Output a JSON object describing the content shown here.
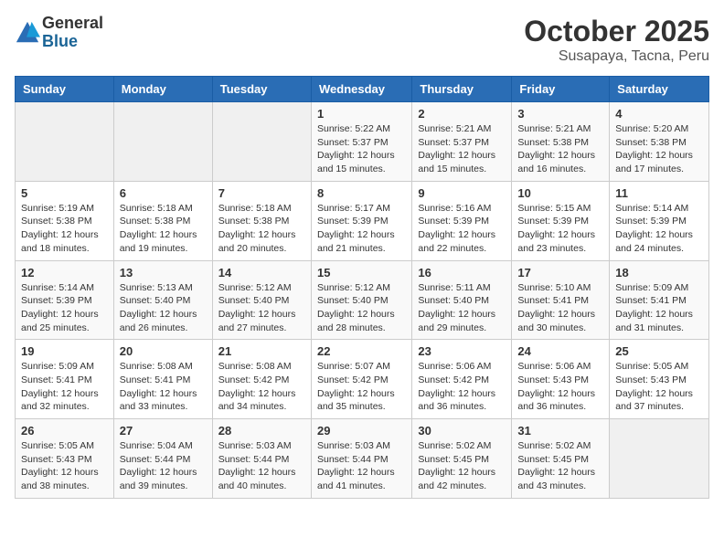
{
  "header": {
    "logo_general": "General",
    "logo_blue": "Blue",
    "month": "October 2025",
    "location": "Susapaya, Tacna, Peru"
  },
  "days_of_week": [
    "Sunday",
    "Monday",
    "Tuesday",
    "Wednesday",
    "Thursday",
    "Friday",
    "Saturday"
  ],
  "weeks": [
    [
      {
        "day": "",
        "info": ""
      },
      {
        "day": "",
        "info": ""
      },
      {
        "day": "",
        "info": ""
      },
      {
        "day": "1",
        "info": "Sunrise: 5:22 AM\nSunset: 5:37 PM\nDaylight: 12 hours\nand 15 minutes."
      },
      {
        "day": "2",
        "info": "Sunrise: 5:21 AM\nSunset: 5:37 PM\nDaylight: 12 hours\nand 15 minutes."
      },
      {
        "day": "3",
        "info": "Sunrise: 5:21 AM\nSunset: 5:38 PM\nDaylight: 12 hours\nand 16 minutes."
      },
      {
        "day": "4",
        "info": "Sunrise: 5:20 AM\nSunset: 5:38 PM\nDaylight: 12 hours\nand 17 minutes."
      }
    ],
    [
      {
        "day": "5",
        "info": "Sunrise: 5:19 AM\nSunset: 5:38 PM\nDaylight: 12 hours\nand 18 minutes."
      },
      {
        "day": "6",
        "info": "Sunrise: 5:18 AM\nSunset: 5:38 PM\nDaylight: 12 hours\nand 19 minutes."
      },
      {
        "day": "7",
        "info": "Sunrise: 5:18 AM\nSunset: 5:38 PM\nDaylight: 12 hours\nand 20 minutes."
      },
      {
        "day": "8",
        "info": "Sunrise: 5:17 AM\nSunset: 5:39 PM\nDaylight: 12 hours\nand 21 minutes."
      },
      {
        "day": "9",
        "info": "Sunrise: 5:16 AM\nSunset: 5:39 PM\nDaylight: 12 hours\nand 22 minutes."
      },
      {
        "day": "10",
        "info": "Sunrise: 5:15 AM\nSunset: 5:39 PM\nDaylight: 12 hours\nand 23 minutes."
      },
      {
        "day": "11",
        "info": "Sunrise: 5:14 AM\nSunset: 5:39 PM\nDaylight: 12 hours\nand 24 minutes."
      }
    ],
    [
      {
        "day": "12",
        "info": "Sunrise: 5:14 AM\nSunset: 5:39 PM\nDaylight: 12 hours\nand 25 minutes."
      },
      {
        "day": "13",
        "info": "Sunrise: 5:13 AM\nSunset: 5:40 PM\nDaylight: 12 hours\nand 26 minutes."
      },
      {
        "day": "14",
        "info": "Sunrise: 5:12 AM\nSunset: 5:40 PM\nDaylight: 12 hours\nand 27 minutes."
      },
      {
        "day": "15",
        "info": "Sunrise: 5:12 AM\nSunset: 5:40 PM\nDaylight: 12 hours\nand 28 minutes."
      },
      {
        "day": "16",
        "info": "Sunrise: 5:11 AM\nSunset: 5:40 PM\nDaylight: 12 hours\nand 29 minutes."
      },
      {
        "day": "17",
        "info": "Sunrise: 5:10 AM\nSunset: 5:41 PM\nDaylight: 12 hours\nand 30 minutes."
      },
      {
        "day": "18",
        "info": "Sunrise: 5:09 AM\nSunset: 5:41 PM\nDaylight: 12 hours\nand 31 minutes."
      }
    ],
    [
      {
        "day": "19",
        "info": "Sunrise: 5:09 AM\nSunset: 5:41 PM\nDaylight: 12 hours\nand 32 minutes."
      },
      {
        "day": "20",
        "info": "Sunrise: 5:08 AM\nSunset: 5:41 PM\nDaylight: 12 hours\nand 33 minutes."
      },
      {
        "day": "21",
        "info": "Sunrise: 5:08 AM\nSunset: 5:42 PM\nDaylight: 12 hours\nand 34 minutes."
      },
      {
        "day": "22",
        "info": "Sunrise: 5:07 AM\nSunset: 5:42 PM\nDaylight: 12 hours\nand 35 minutes."
      },
      {
        "day": "23",
        "info": "Sunrise: 5:06 AM\nSunset: 5:42 PM\nDaylight: 12 hours\nand 36 minutes."
      },
      {
        "day": "24",
        "info": "Sunrise: 5:06 AM\nSunset: 5:43 PM\nDaylight: 12 hours\nand 36 minutes."
      },
      {
        "day": "25",
        "info": "Sunrise: 5:05 AM\nSunset: 5:43 PM\nDaylight: 12 hours\nand 37 minutes."
      }
    ],
    [
      {
        "day": "26",
        "info": "Sunrise: 5:05 AM\nSunset: 5:43 PM\nDaylight: 12 hours\nand 38 minutes."
      },
      {
        "day": "27",
        "info": "Sunrise: 5:04 AM\nSunset: 5:44 PM\nDaylight: 12 hours\nand 39 minutes."
      },
      {
        "day": "28",
        "info": "Sunrise: 5:03 AM\nSunset: 5:44 PM\nDaylight: 12 hours\nand 40 minutes."
      },
      {
        "day": "29",
        "info": "Sunrise: 5:03 AM\nSunset: 5:44 PM\nDaylight: 12 hours\nand 41 minutes."
      },
      {
        "day": "30",
        "info": "Sunrise: 5:02 AM\nSunset: 5:45 PM\nDaylight: 12 hours\nand 42 minutes."
      },
      {
        "day": "31",
        "info": "Sunrise: 5:02 AM\nSunset: 5:45 PM\nDaylight: 12 hours\nand 43 minutes."
      },
      {
        "day": "",
        "info": ""
      }
    ]
  ]
}
